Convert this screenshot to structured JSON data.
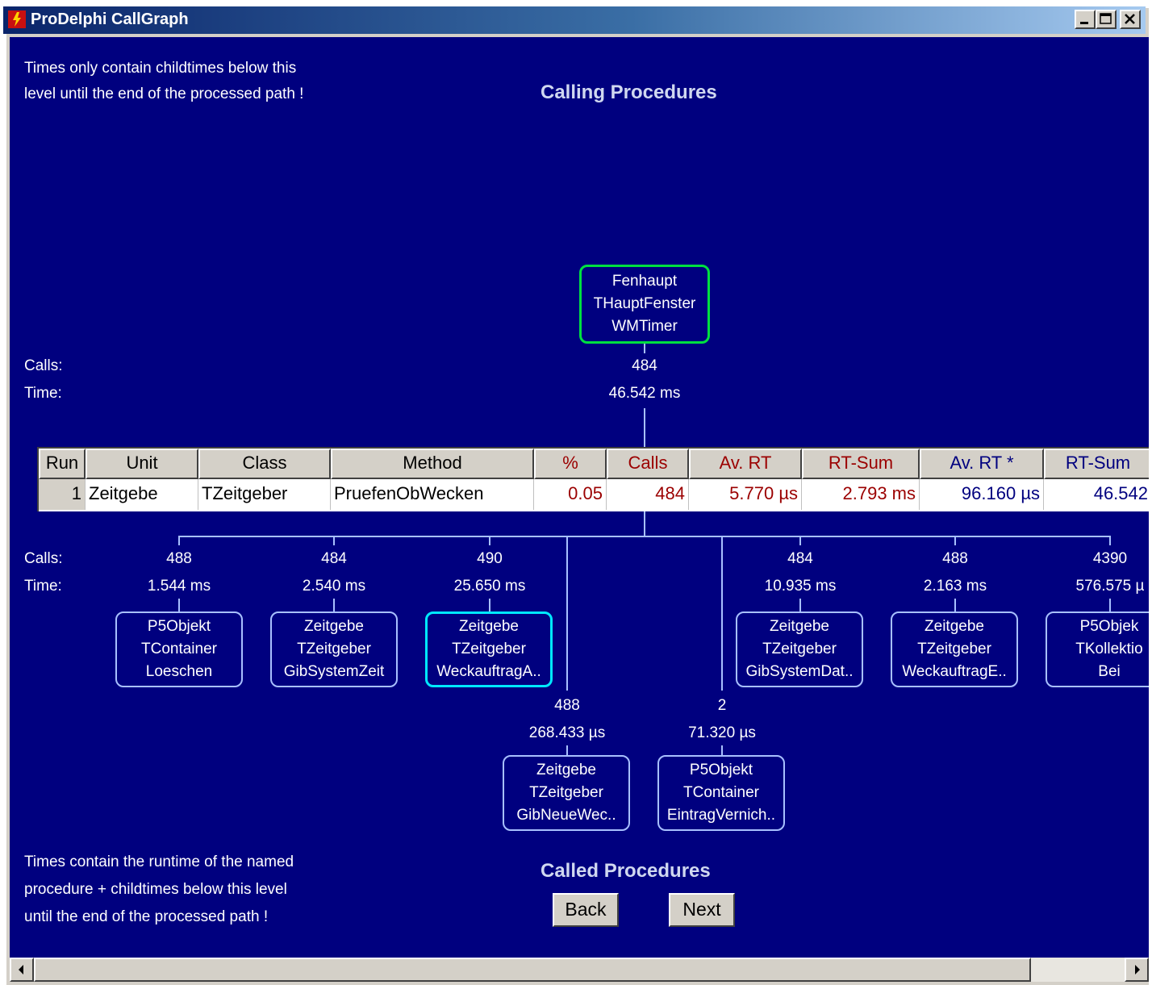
{
  "window": {
    "title": "ProDelphi CallGraph"
  },
  "notes": {
    "top_line1": "Times only contain childtimes below this",
    "top_line2": "level until the end of the processed path !",
    "bottom_line1": "Times contain the runtime of the named",
    "bottom_line2": "procedure + childtimes below  this level",
    "bottom_line3": "until the end of the processed path !"
  },
  "headings": {
    "calling": "Calling Procedures",
    "called": "Called Procedures"
  },
  "labels": {
    "calls": "Calls:",
    "time": "Time:"
  },
  "root": {
    "unit": "Fenhaupt",
    "class": "THauptFenster",
    "method": "WMTimer",
    "calls": "484",
    "time": "46.542 ms"
  },
  "table": {
    "headers": [
      "Run",
      "Unit",
      "Class",
      "Method",
      "%",
      "Calls",
      "Av. RT",
      "RT-Sum",
      "Av. RT *",
      "RT-Sum"
    ],
    "row": [
      "1",
      "Zeitgebe",
      "TZeitgeber",
      "PruefenObWecken",
      "0.05",
      "484",
      "5.770 µs",
      "2.793 ms",
      "96.160 µs",
      "46.542"
    ]
  },
  "children": [
    {
      "calls": "488",
      "time": "1.544 ms",
      "unit": "P5Objekt",
      "class": "TContainer",
      "method": "Loeschen"
    },
    {
      "calls": "484",
      "time": "2.540 ms",
      "unit": "Zeitgebe",
      "class": "TZeitgeber",
      "method": "GibSystemZeit"
    },
    {
      "calls": "490",
      "time": "25.650 ms",
      "unit": "Zeitgebe",
      "class": "TZeitgeber",
      "method": "WeckauftragA.."
    },
    {
      "calls": "488",
      "time": "268.433 µs",
      "unit": "Zeitgebe",
      "class": "TZeitgeber",
      "method": "GibNeueWec.."
    },
    {
      "calls": "2",
      "time": "71.320 µs",
      "unit": "P5Objekt",
      "class": "TContainer",
      "method": "EintragVernich.."
    },
    {
      "calls": "484",
      "time": "10.935 ms",
      "unit": "Zeitgebe",
      "class": "TZeitgeber",
      "method": "GibSystemDat.."
    },
    {
      "calls": "488",
      "time": "2.163 ms",
      "unit": "Zeitgebe",
      "class": "TZeitgeber",
      "method": "WeckauftragE.."
    },
    {
      "calls": "4390",
      "time": "576.575 µ",
      "unit": "P5Objek",
      "class": "TKollektio",
      "method": "Bei"
    }
  ],
  "buttons": {
    "back": "Back",
    "next": "Next"
  }
}
